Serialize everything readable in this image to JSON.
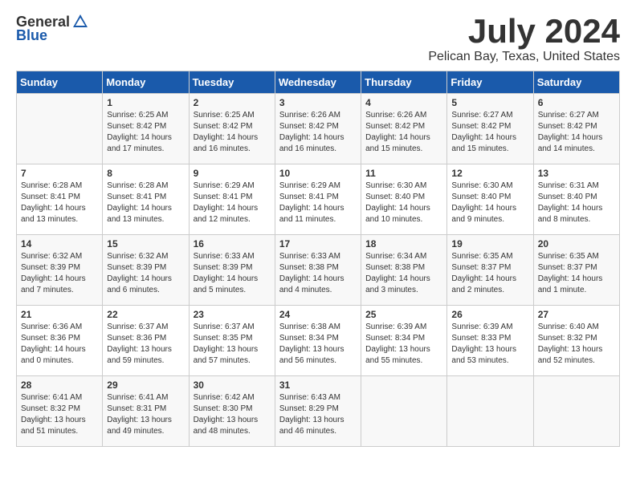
{
  "logo": {
    "general": "General",
    "blue": "Blue"
  },
  "title": "July 2024",
  "location": "Pelican Bay, Texas, United States",
  "weekdays": [
    "Sunday",
    "Monday",
    "Tuesday",
    "Wednesday",
    "Thursday",
    "Friday",
    "Saturday"
  ],
  "weeks": [
    [
      {
        "day": "",
        "info": ""
      },
      {
        "day": "1",
        "info": "Sunrise: 6:25 AM\nSunset: 8:42 PM\nDaylight: 14 hours\nand 17 minutes."
      },
      {
        "day": "2",
        "info": "Sunrise: 6:25 AM\nSunset: 8:42 PM\nDaylight: 14 hours\nand 16 minutes."
      },
      {
        "day": "3",
        "info": "Sunrise: 6:26 AM\nSunset: 8:42 PM\nDaylight: 14 hours\nand 16 minutes."
      },
      {
        "day": "4",
        "info": "Sunrise: 6:26 AM\nSunset: 8:42 PM\nDaylight: 14 hours\nand 15 minutes."
      },
      {
        "day": "5",
        "info": "Sunrise: 6:27 AM\nSunset: 8:42 PM\nDaylight: 14 hours\nand 15 minutes."
      },
      {
        "day": "6",
        "info": "Sunrise: 6:27 AM\nSunset: 8:42 PM\nDaylight: 14 hours\nand 14 minutes."
      }
    ],
    [
      {
        "day": "7",
        "info": "Sunrise: 6:28 AM\nSunset: 8:41 PM\nDaylight: 14 hours\nand 13 minutes."
      },
      {
        "day": "8",
        "info": "Sunrise: 6:28 AM\nSunset: 8:41 PM\nDaylight: 14 hours\nand 13 minutes."
      },
      {
        "day": "9",
        "info": "Sunrise: 6:29 AM\nSunset: 8:41 PM\nDaylight: 14 hours\nand 12 minutes."
      },
      {
        "day": "10",
        "info": "Sunrise: 6:29 AM\nSunset: 8:41 PM\nDaylight: 14 hours\nand 11 minutes."
      },
      {
        "day": "11",
        "info": "Sunrise: 6:30 AM\nSunset: 8:40 PM\nDaylight: 14 hours\nand 10 minutes."
      },
      {
        "day": "12",
        "info": "Sunrise: 6:30 AM\nSunset: 8:40 PM\nDaylight: 14 hours\nand 9 minutes."
      },
      {
        "day": "13",
        "info": "Sunrise: 6:31 AM\nSunset: 8:40 PM\nDaylight: 14 hours\nand 8 minutes."
      }
    ],
    [
      {
        "day": "14",
        "info": "Sunrise: 6:32 AM\nSunset: 8:39 PM\nDaylight: 14 hours\nand 7 minutes."
      },
      {
        "day": "15",
        "info": "Sunrise: 6:32 AM\nSunset: 8:39 PM\nDaylight: 14 hours\nand 6 minutes."
      },
      {
        "day": "16",
        "info": "Sunrise: 6:33 AM\nSunset: 8:39 PM\nDaylight: 14 hours\nand 5 minutes."
      },
      {
        "day": "17",
        "info": "Sunrise: 6:33 AM\nSunset: 8:38 PM\nDaylight: 14 hours\nand 4 minutes."
      },
      {
        "day": "18",
        "info": "Sunrise: 6:34 AM\nSunset: 8:38 PM\nDaylight: 14 hours\nand 3 minutes."
      },
      {
        "day": "19",
        "info": "Sunrise: 6:35 AM\nSunset: 8:37 PM\nDaylight: 14 hours\nand 2 minutes."
      },
      {
        "day": "20",
        "info": "Sunrise: 6:35 AM\nSunset: 8:37 PM\nDaylight: 14 hours\nand 1 minute."
      }
    ],
    [
      {
        "day": "21",
        "info": "Sunrise: 6:36 AM\nSunset: 8:36 PM\nDaylight: 14 hours\nand 0 minutes."
      },
      {
        "day": "22",
        "info": "Sunrise: 6:37 AM\nSunset: 8:36 PM\nDaylight: 13 hours\nand 59 minutes."
      },
      {
        "day": "23",
        "info": "Sunrise: 6:37 AM\nSunset: 8:35 PM\nDaylight: 13 hours\nand 57 minutes."
      },
      {
        "day": "24",
        "info": "Sunrise: 6:38 AM\nSunset: 8:34 PM\nDaylight: 13 hours\nand 56 minutes."
      },
      {
        "day": "25",
        "info": "Sunrise: 6:39 AM\nSunset: 8:34 PM\nDaylight: 13 hours\nand 55 minutes."
      },
      {
        "day": "26",
        "info": "Sunrise: 6:39 AM\nSunset: 8:33 PM\nDaylight: 13 hours\nand 53 minutes."
      },
      {
        "day": "27",
        "info": "Sunrise: 6:40 AM\nSunset: 8:32 PM\nDaylight: 13 hours\nand 52 minutes."
      }
    ],
    [
      {
        "day": "28",
        "info": "Sunrise: 6:41 AM\nSunset: 8:32 PM\nDaylight: 13 hours\nand 51 minutes."
      },
      {
        "day": "29",
        "info": "Sunrise: 6:41 AM\nSunset: 8:31 PM\nDaylight: 13 hours\nand 49 minutes."
      },
      {
        "day": "30",
        "info": "Sunrise: 6:42 AM\nSunset: 8:30 PM\nDaylight: 13 hours\nand 48 minutes."
      },
      {
        "day": "31",
        "info": "Sunrise: 6:43 AM\nSunset: 8:29 PM\nDaylight: 13 hours\nand 46 minutes."
      },
      {
        "day": "",
        "info": ""
      },
      {
        "day": "",
        "info": ""
      },
      {
        "day": "",
        "info": ""
      }
    ]
  ]
}
